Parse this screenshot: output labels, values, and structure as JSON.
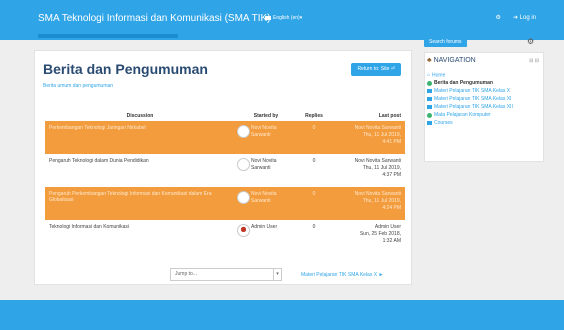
{
  "navbar": {
    "brand": "SMA Teknologi Informasi dan Komunikasi (SMA TIK)",
    "language": "English (en)",
    "login": "Log in"
  },
  "page": {
    "title": "Berita dan Pengumuman",
    "subtitle": "Berita umum dan pengumuman",
    "return_button": "Return to: Site"
  },
  "table": {
    "headers": [
      "Discussion",
      "Started by",
      "Replies",
      "Last post"
    ],
    "rows": [
      {
        "discussion": "Perkembangan Teknologi Jaringan Nirkabel",
        "starter": "Novi Novita Sarwanti",
        "replies": "0",
        "last_post": [
          "Novi Novita Sarwanti",
          "Thu, 11 Jul 2019,",
          "4:41 PM"
        ]
      },
      {
        "discussion": "Pengaruh Teknologi dalam Dunia Pendidikan",
        "starter": "Novi Novita Sarwanti",
        "replies": "0",
        "last_post": [
          "Novi Novita Sarwanti",
          "Thu, 11 Jul 2019,",
          "4:37 PM"
        ]
      },
      {
        "discussion": "Pengaruh Perkembangan Teknologi Informasi dan Komunikasi dalam Era Globalisasi",
        "starter": "Novi Novita Sarwanti",
        "replies": "0",
        "last_post": [
          "Novi Novita Sarwanti",
          "Thu, 11 Jul 2019,",
          "4:24 PM"
        ]
      },
      {
        "discussion": "Teknologi Informasi dan Komunikasi",
        "starter": "Admin User",
        "replies": "0",
        "last_post": [
          "Admin User",
          "Sun, 25 Feb 2018,",
          "1:32 AM"
        ]
      }
    ]
  },
  "jump": {
    "placeholder": "Jump to..."
  },
  "next_link": "Materi Pelajaran TIK SMA Kelas X ►",
  "sidebar": {
    "search_button": "Search forums",
    "navigation_title": "NAVIGATION",
    "items": [
      "Home",
      "Berita dan Pengumuman",
      "Materi Pelajaran TIK SMA Kelas X",
      "Materi Pelajaran TIK SMA Kelas XI",
      "Materi Pelajaran TIK SMA Kelas XII",
      "Mata Pelajaran Komputer",
      "Courses"
    ]
  }
}
